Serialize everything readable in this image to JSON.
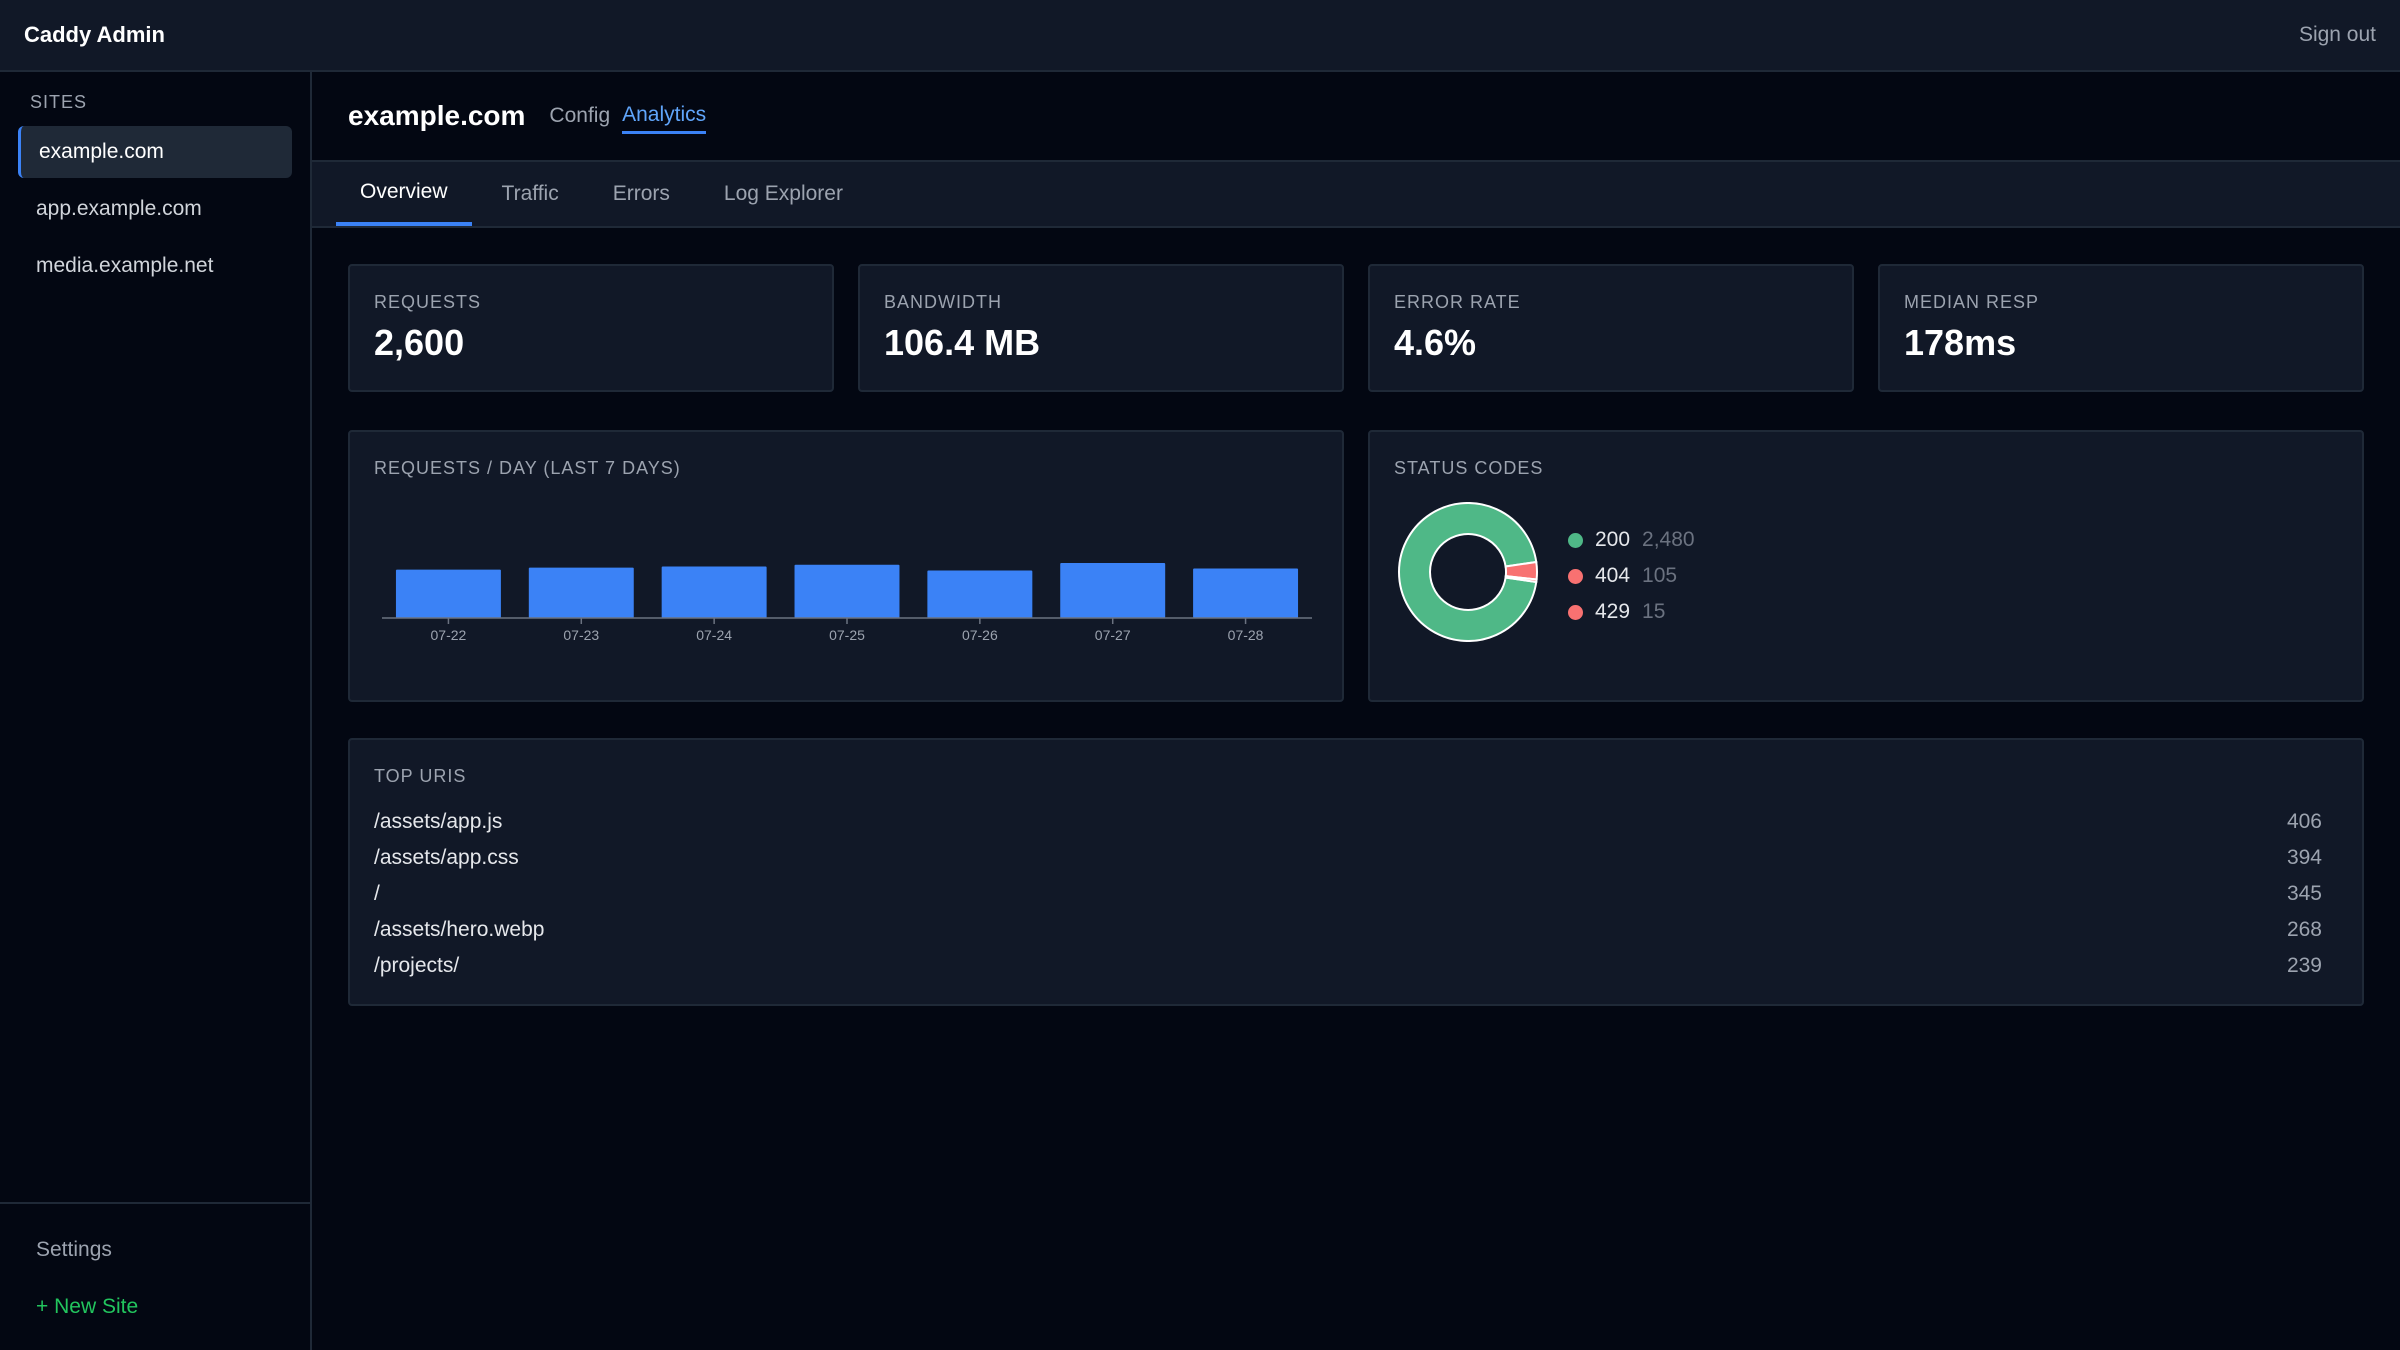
{
  "app": {
    "title": "Caddy Admin",
    "sign_out": "Sign out"
  },
  "sidebar": {
    "section_label": "SITES",
    "sites": [
      {
        "label": "example.com",
        "active": true
      },
      {
        "label": "app.example.com",
        "active": false
      },
      {
        "label": "media.example.net",
        "active": false
      }
    ],
    "settings_label": "Settings",
    "new_site_label": "+ New Site"
  },
  "site_header": {
    "title": "example.com",
    "tabs": [
      {
        "label": "Config",
        "active": false
      },
      {
        "label": "Analytics",
        "active": true
      }
    ]
  },
  "subtabs": [
    {
      "label": "Overview",
      "active": true
    },
    {
      "label": "Traffic",
      "active": false
    },
    {
      "label": "Errors",
      "active": false
    },
    {
      "label": "Log Explorer",
      "active": false
    }
  ],
  "stats": [
    {
      "label": "REQUESTS",
      "value": "2,600"
    },
    {
      "label": "BANDWIDTH",
      "value": "106.4 MB"
    },
    {
      "label": "ERROR RATE",
      "value": "4.6%"
    },
    {
      "label": "MEDIAN RESP",
      "value": "178ms"
    }
  ],
  "colors": {
    "accent": "#3b82f6",
    "status_200": "#4fb887",
    "status_404": "#f87171",
    "status_429": "#f87171",
    "new_site": "#22c55e"
  },
  "chart_data": [
    {
      "type": "bar",
      "title": "REQUESTS / DAY (LAST 7 DAYS)",
      "categories": [
        "07-22",
        "07-23",
        "07-24",
        "07-25",
        "07-26",
        "07-27",
        "07-28"
      ],
      "values": [
        365,
        380,
        388,
        402,
        358,
        415,
        373
      ],
      "ylim": [
        0,
        650
      ],
      "grid": false
    },
    {
      "type": "pie",
      "title": "STATUS CODES",
      "donut": true,
      "labels": [
        "200",
        "404",
        "429"
      ],
      "values": [
        2480,
        105,
        15
      ]
    }
  ],
  "top_uris": {
    "title": "TOP URIS",
    "rows": [
      {
        "path": "/assets/app.js",
        "count": "406"
      },
      {
        "path": "/assets/app.css",
        "count": "394"
      },
      {
        "path": "/",
        "count": "345"
      },
      {
        "path": "/assets/hero.webp",
        "count": "268"
      },
      {
        "path": "/projects/",
        "count": "239"
      }
    ]
  }
}
